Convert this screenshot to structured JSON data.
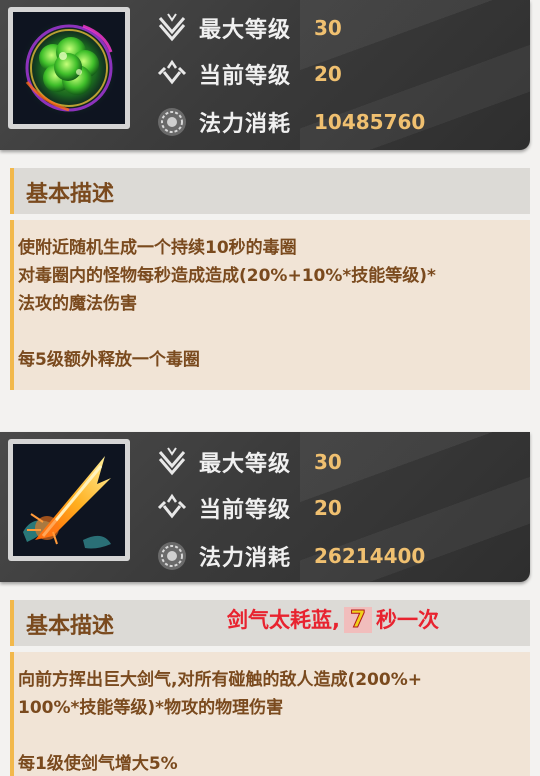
{
  "skills": [
    {
      "stats": {
        "max_level_label": "最大等级",
        "max_level_value": "30",
        "current_level_label": "当前等级",
        "current_level_value": "20",
        "mana_cost_label": "法力消耗",
        "mana_cost_value": "10485760"
      },
      "section_title": "基本描述",
      "description": [
        "使附近随机生成一个持续10秒的毒圈",
        "对毒圈内的怪物每秒造成造成(20%+10%*技能等级)*",
        "法攻的魔法伤害",
        "每5级额外释放一个毒圈"
      ]
    },
    {
      "stats": {
        "max_level_label": "最大等级",
        "max_level_value": "30",
        "current_level_label": "当前等级",
        "current_level_value": "20",
        "mana_cost_label": "法力消耗",
        "mana_cost_value": "26214400"
      },
      "section_title": "基本描述",
      "annotation": {
        "before": "剑气太耗蓝,",
        "number": "7",
        "after": "秒一次"
      },
      "description": [
        "向前方挥出巨大剑气,对所有碰触的敌人造成(200%+",
        "100%*技能等级)*物攻的物理伤害",
        "每1级使剑气增大5%"
      ]
    }
  ],
  "colors": {
    "label": "#f0f0f0",
    "value": "#f0c070",
    "desc_text": "#7a4a1e",
    "accent": "#f2b84b",
    "annotation": "#e8232f"
  }
}
